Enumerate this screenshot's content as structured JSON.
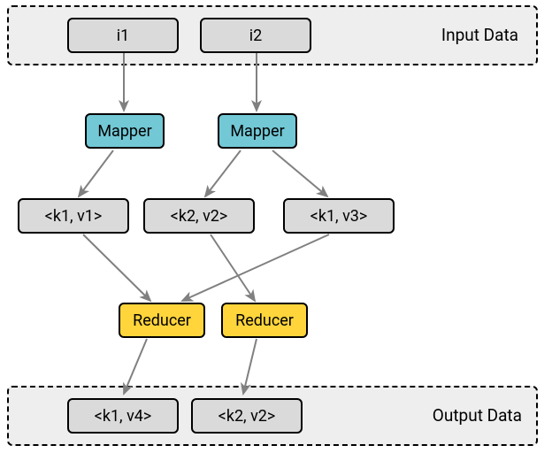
{
  "groups": {
    "input": {
      "label": "Input Data"
    },
    "output": {
      "label": "Output Data"
    }
  },
  "nodes": {
    "i1": {
      "label": "i1"
    },
    "i2": {
      "label": "i2"
    },
    "mapper1": {
      "label": "Mapper"
    },
    "mapper2": {
      "label": "Mapper"
    },
    "kv1": {
      "label": "<k1, v1>"
    },
    "kv2": {
      "label": "<k2, v2>"
    },
    "kv3": {
      "label": "<k1, v3>"
    },
    "reducer1": {
      "label": "Reducer"
    },
    "reducer2": {
      "label": "Reducer"
    },
    "out1": {
      "label": "<k1, v4>"
    },
    "out2": {
      "label": "<k2, v2>"
    }
  },
  "colors": {
    "gray": "#dadada",
    "teal": "#72c8d5",
    "yellow": "#ffd53b",
    "arrow": "#808080"
  },
  "edges": [
    [
      "i1",
      "mapper1"
    ],
    [
      "i2",
      "mapper2"
    ],
    [
      "mapper1",
      "kv1"
    ],
    [
      "mapper2",
      "kv2"
    ],
    [
      "mapper2",
      "kv3"
    ],
    [
      "kv1",
      "reducer1"
    ],
    [
      "kv2",
      "reducer2"
    ],
    [
      "kv3",
      "reducer1"
    ],
    [
      "reducer1",
      "out1"
    ],
    [
      "reducer2",
      "out2"
    ]
  ]
}
